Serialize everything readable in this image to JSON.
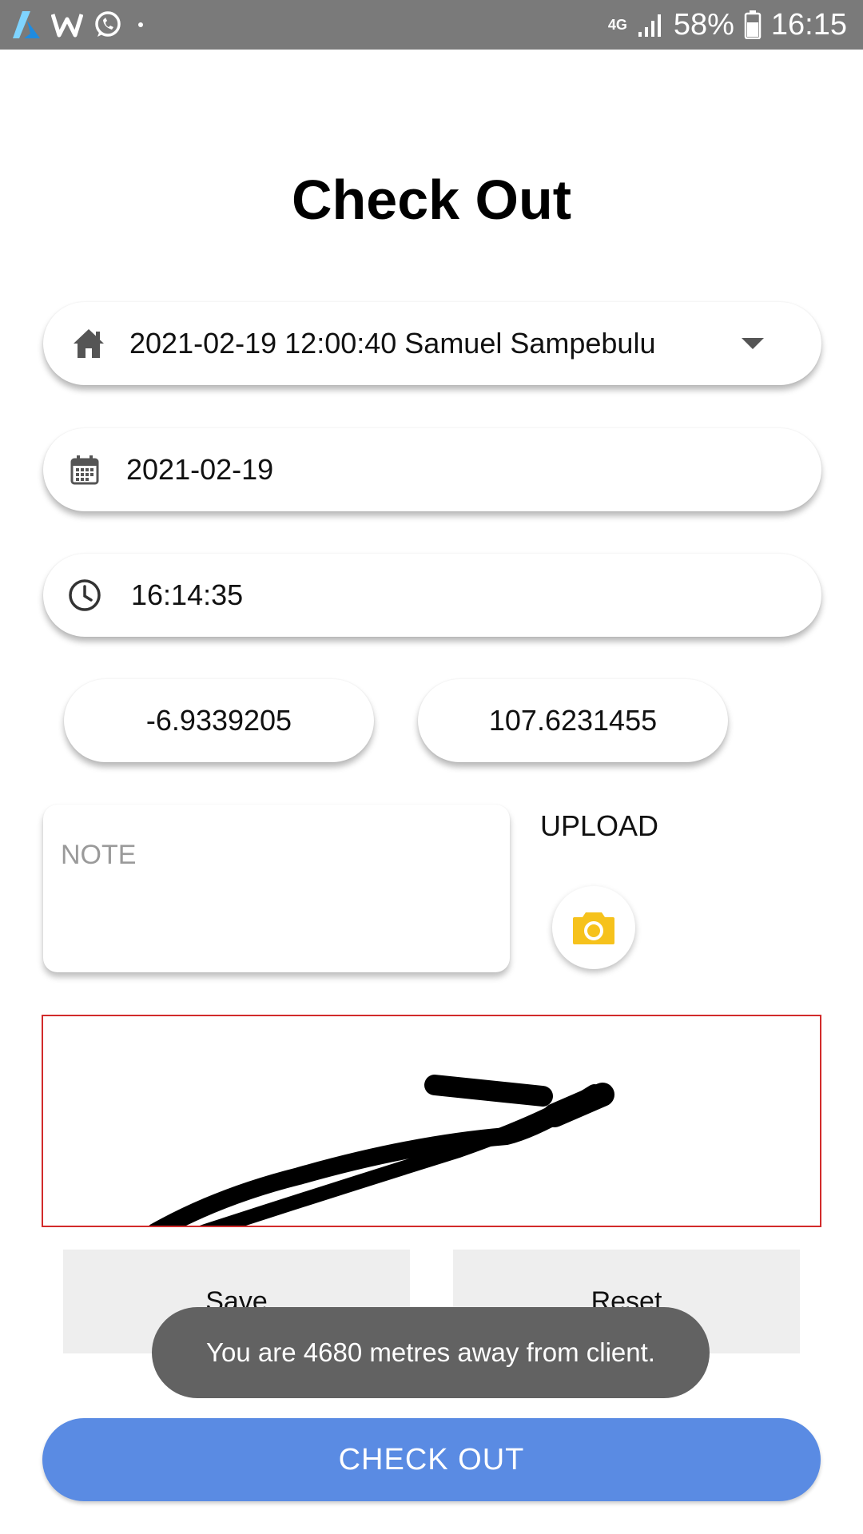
{
  "status_bar": {
    "network_type": "4G",
    "battery": "58%",
    "time": "16:15",
    "icons": [
      "azure-icon",
      "w-app-icon",
      "whatsapp-icon",
      "notification-dot-icon",
      "signal-icon",
      "battery-icon"
    ]
  },
  "page": {
    "title": "Check Out"
  },
  "form": {
    "client": {
      "value": "2021-02-19 12:00:40 Samuel Sampebulu",
      "icon": "home-icon"
    },
    "date": {
      "value": "2021-02-19",
      "icon": "calendar-icon"
    },
    "time": {
      "value": "16:14:35",
      "icon": "clock-icon"
    },
    "latitude": "-6.9339205",
    "longitude": "107.6231455",
    "note": {
      "placeholder": "NOTE",
      "value": ""
    },
    "upload": {
      "label": "UPLOAD",
      "icon": "camera-icon"
    }
  },
  "signature": {
    "save_label": "Save",
    "reset_label": "Reset",
    "border_color": "#d22b2b"
  },
  "toast": {
    "message": "You are 4680 metres away from client."
  },
  "checkout": {
    "label": "CHECK OUT",
    "color": "#5a8be3"
  },
  "colors": {
    "status_bar": "#7a7a7a",
    "camera_accent": "#f6c21c"
  }
}
